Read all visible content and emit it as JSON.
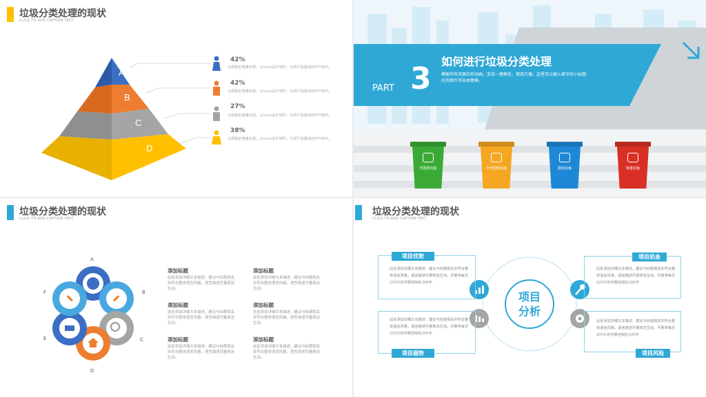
{
  "slide1": {
    "title": "垃圾分类处理的现状",
    "subtitle": "CLICK TO ADD CAPTION TEXT",
    "pyramid": [
      "A",
      "B",
      "C",
      "D"
    ],
    "items": [
      {
        "pct": "42%",
        "desc": "从顾客的角度出发，从viaxi设计制作，为您打造最佳的PPT演示。"
      },
      {
        "pct": "42%",
        "desc": "从顾客的角度出发，从viaxi设计制作，为您打造最佳的PPT演示。"
      },
      {
        "pct": "27%",
        "desc": "从顾客的角度出发，从viaxi设计制作，为您打造最佳的PPT演示。"
      },
      {
        "pct": "38%",
        "desc": "从顾客的角度出发，从viaxi设计制作，为您打造最佳的PPT演示。"
      }
    ],
    "colors": [
      "#3b6fc4",
      "#ed7d31",
      "#a5a5a5",
      "#ffc000"
    ]
  },
  "slide2": {
    "part_label": "PART",
    "part_number": "3",
    "title": "如何进行垃圾分类处理",
    "desc_line1": "模板所有页面均有动画，支持一键换色，修改方便。这里可以输入章节的小标题,",
    "desc_line2": "内页图片可自由替换。",
    "bins": [
      {
        "label": "可回收垃圾",
        "color": "#3aaa35"
      },
      {
        "label": "不可回收垃圾",
        "color": "#f5a623"
      },
      {
        "label": "厨余垃圾",
        "color": "#1e88d6"
      },
      {
        "label": "有害垃圾",
        "color": "#d93025"
      }
    ]
  },
  "slide3": {
    "title": "垃圾分类处理的现状",
    "subtitle": "CLICK TO ADD CAPTION TEXT",
    "petal_letters": [
      "A",
      "B",
      "C",
      "D",
      "E",
      "F"
    ],
    "blocks": [
      {
        "h": "添加标题",
        "p": "此处添加详细文本描述，建议与标题相关并符合整体语言风格，语言描述尽量简洁生动。"
      },
      {
        "h": "添加标题",
        "p": "此处添加详细文本描述，建议与标题相关并符合整体语言风格，语言描述尽量简洁生动。"
      },
      {
        "h": "添加标题",
        "p": "此处添加详细文本描述，建议与标题相关并符合整体语言风格，语言描述尽量简洁生动。"
      },
      {
        "h": "添加标题",
        "p": "此处添加详细文本描述，建议与标题相关并符合整体语言风格，语言描述尽量简洁生动。"
      },
      {
        "h": "添加标题",
        "p": "此处添加详细文本描述，建议与标题相关并符合整体语言风格，语言描述尽量简洁生动。"
      },
      {
        "h": "添加标题",
        "p": "此处添加详细文本描述，建议与标题相关并符合整体语言风格，语言描述尽量简洁生动。"
      }
    ]
  },
  "slide4": {
    "title": "垃圾分类处理的现状",
    "subtitle": "CLICK TO ADD CAPTION TEXT",
    "center_line1": "项目",
    "center_line2": "分析",
    "quads": [
      {
        "tag": "项目优势",
        "text": "此处添加详细文本描述，建议与标题相关并符合整体语言风格，语言描述尽量简洁生动。尽量将每页幻灯片的字数控制在200字"
      },
      {
        "tag": "项目机会",
        "text": "此处添加详细文本描述，建议与标题相关并符合整体语言风格，语言描述尽量简洁生动。尽量将每页幻灯片的字数控制在200字"
      },
      {
        "tag": "项目弱势",
        "text": "此处添加详细文本描述，建议与标题相关并符合整体语言风格，语言描述尽量简洁生动。尽量将每页幻灯片的字数控制在200字"
      },
      {
        "tag": "项目风险",
        "text": "此处添加详细文本描述，建议与标题相关并符合整体语言风格，语言描述尽量简洁生动。尽量将每页幻灯片的字数控制在200字"
      }
    ]
  }
}
